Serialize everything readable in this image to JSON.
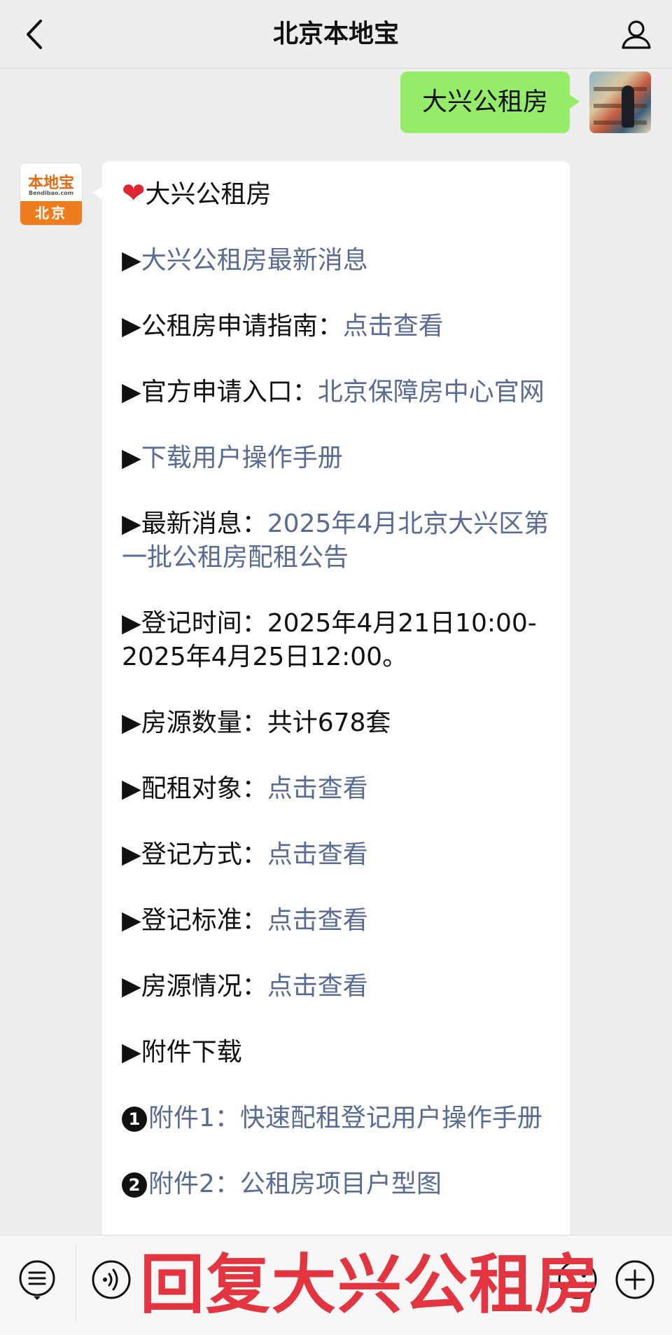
{
  "header": {
    "title": "北京本地宝"
  },
  "outgoing_message": {
    "text": "大兴公租房"
  },
  "bot_avatar": {
    "logo_text": "本地宝",
    "logo_sub": "Bendibao.com",
    "city": "北京"
  },
  "reply": {
    "heart": "❤",
    "title": "大兴公租房",
    "items": [
      {
        "prefix": "▶",
        "label": "",
        "link": "大兴公租房最新消息"
      },
      {
        "prefix": "▶",
        "label": "公租房申请指南：",
        "link": "点击查看"
      },
      {
        "prefix": "▶",
        "label": "官方申请入口：",
        "link": "北京保障房中心官网"
      },
      {
        "prefix": "▶",
        "label": "",
        "link": "下载用户操作手册"
      },
      {
        "prefix": "▶",
        "label": "最新消息：",
        "link": "2025年4月北京大兴区第一批公租房配租公告"
      },
      {
        "prefix": "▶",
        "label": "登记时间：",
        "text": "2025年4月21日10:00-2025年4月25日12:00。"
      },
      {
        "prefix": "▶",
        "label": "房源数量：",
        "text": "共计678套"
      },
      {
        "prefix": "▶",
        "label": "配租对象：",
        "link": "点击查看"
      },
      {
        "prefix": "▶",
        "label": "登记方式：",
        "link": "点击查看"
      },
      {
        "prefix": "▶",
        "label": "登记标准：",
        "link": "点击查看"
      },
      {
        "prefix": "▶",
        "label": "房源情况：",
        "link": "点击查看"
      },
      {
        "prefix": "▶",
        "label": "附件下载"
      }
    ],
    "attachments": [
      {
        "num": "1",
        "link": "附件1：快速配租登记用户操作手册"
      },
      {
        "num": "2",
        "link": "附件2：公租房项目户型图"
      }
    ]
  },
  "overlay": {
    "text": "回复大兴公租房"
  },
  "colors": {
    "link": "#576b95",
    "outgoing_bubble": "#95ec69",
    "overlay_red": "#e4343f",
    "brand_orange": "#f07d1d"
  },
  "icons": {
    "back": "chevron-left-icon",
    "profile": "person-icon",
    "menu": "list-menu-icon",
    "voice": "voice-icon",
    "emoji": "emoji-icon",
    "plus": "plus-icon"
  }
}
